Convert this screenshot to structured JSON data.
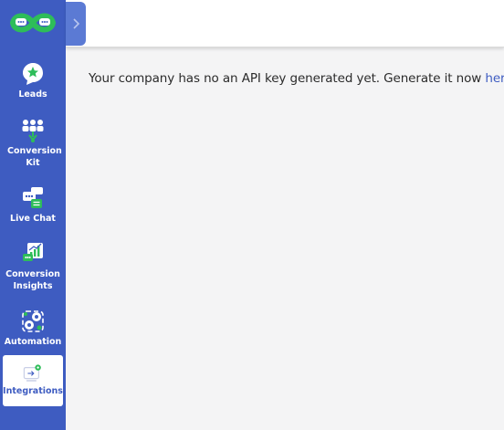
{
  "sidebar": {
    "logo_icon": "infinity-chat-logo",
    "items": [
      {
        "label": "Leads",
        "icon": "star-chat-icon"
      },
      {
        "label": "Conversion Kit",
        "icon": "group-icon"
      },
      {
        "label": "Live Chat",
        "icon": "chat-bubbles-icon"
      },
      {
        "label": "Conversion Insights",
        "icon": "chart-icon"
      },
      {
        "label": "Automation",
        "icon": "gears-icon"
      },
      {
        "label": "Integrations",
        "icon": "monitor-gear-icon",
        "active": true
      }
    ]
  },
  "main": {
    "message_text": "Your company has no an API key generated yet. Generate it now ",
    "message_link": "here"
  },
  "colors": {
    "sidebar_bg": "#3e5cc1",
    "accent_green": "#2ebd59",
    "link": "#3e5cc1"
  }
}
